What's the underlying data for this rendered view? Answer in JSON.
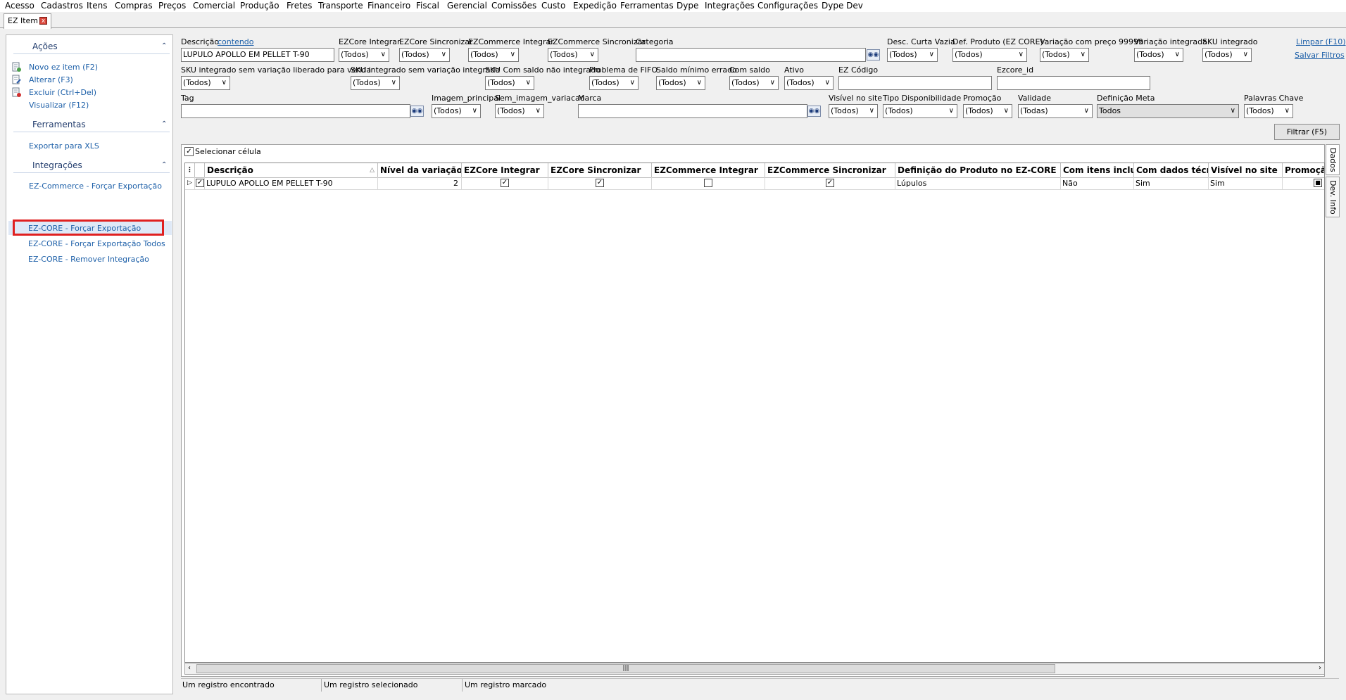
{
  "menu": [
    "Acesso",
    "Cadastros",
    "Itens",
    "Compras",
    "Preços",
    "Comercial",
    "Produção",
    "Fretes",
    "Transporte",
    "Financeiro",
    "Fiscal",
    "Gerencial",
    "Comissões",
    "Custo",
    "Expedição",
    "Ferramentas",
    "Dype",
    "Integrações",
    "Configurações",
    "Dype Dev"
  ],
  "tab": {
    "label": "EZ Item",
    "close": "x"
  },
  "sidebar": {
    "acoes": {
      "title": "Ações",
      "items": [
        "Novo ez item (F2)",
        "Alterar (F3)",
        "Excluir (Ctrl+Del)",
        "Visualizar (F12)"
      ]
    },
    "ferramentas": {
      "title": "Ferramentas",
      "items": [
        "Exportar para XLS"
      ]
    },
    "integracoes": {
      "title": "Integrações",
      "items": [
        "EZ-Commerce - Forçar Exportação",
        "EZ-CORE - Forçar Exportação",
        "EZ-CORE - Forçar Exportação Todos",
        "EZ-CORE - Remover Integração"
      ]
    }
  },
  "filters": {
    "descricao_label": "Descrição",
    "contendo": "contendo",
    "descricao_value": "LUPULO APOLLO EM PELLET T-90",
    "ezcore_integrar": {
      "label": "EZCore Integrar",
      "value": "(Todos)"
    },
    "ezcore_sincronizar": {
      "label": "EZCore Sincronizar",
      "value": "(Todos)"
    },
    "ezcommerce_integrar": {
      "label": "EZCommerce Integrar",
      "value": "(Todos)"
    },
    "ezcommerce_sincronizar": {
      "label": "EZCommerce Sincronizar",
      "value": "(Todos)"
    },
    "categoria_label": "Categoria",
    "desc_curta_vazia": {
      "label": "Desc. Curta Vazia",
      "value": "(Todos)"
    },
    "def_produto": {
      "label": "Def. Produto (EZ CORE)",
      "value": "(Todos)"
    },
    "variacao_preco": {
      "label": "Variação com preço 99999",
      "value": "(Todos)"
    },
    "variacao_integrada": {
      "label": "Variação integrada",
      "value": "(Todos)"
    },
    "sku_integrado": {
      "label": "SKU integrado",
      "value": "(Todos)"
    },
    "limpar": "Limpar (F10)",
    "salvar": "Salvar Filtros",
    "sku_sem_var_lib": {
      "label": "SKU integrado sem variação liberado para venda",
      "value": "(Todos)"
    },
    "sku_sem_var_int": {
      "label": "SKU integrado sem variação integrada",
      "value": "(Todos)"
    },
    "sku_saldo_nao_int": {
      "label": "SKU Com saldo não integrado",
      "value": "(Todos)"
    },
    "problema_fifo": {
      "label": "Problema de FIFO",
      "value": "(Todos)"
    },
    "saldo_min": {
      "label": "Saldo mínimo errado",
      "value": "(Todos)"
    },
    "com_saldo": {
      "label": "Com saldo",
      "value": "(Todos)"
    },
    "ativo": {
      "label": "Ativo",
      "value": "(Todos)"
    },
    "ez_codigo_label": "EZ Código",
    "ezcore_id_label": "Ezcore_id",
    "tag_label": "Tag",
    "imagem_principal": {
      "label": "Imagem_principal",
      "value": "(Todos)"
    },
    "sem_imagem_variacao": {
      "label": "Sem_imagem_variacao",
      "value": "(Todos)"
    },
    "marca_label": "Marca",
    "visivel_site": {
      "label": "Visível no site",
      "value": "(Todos)"
    },
    "tipo_disp": {
      "label": "Tipo Disponibilidade",
      "value": "(Todos)"
    },
    "promocao": {
      "label": "Promoção",
      "value": "(Todos)"
    },
    "validade": {
      "label": "Validade",
      "value": "(Todas)"
    },
    "definicao_meta": {
      "label": "Definição Meta",
      "value": "Todos"
    },
    "palavras_chave": {
      "label": "Palavras Chave",
      "value": "(Todos)"
    },
    "filtrar": "Filtrar (F5)"
  },
  "grid": {
    "selecionar_celula": "Selecionar célula",
    "columns": [
      "Descrição",
      "Nível da variação",
      "EZCore Integrar",
      "EZCore Sincronizar",
      "EZCommerce Integrar",
      "EZCommerce Sincronizar",
      "Definição do Produto no EZ-CORE",
      "Com itens inclu",
      "Com dados técr",
      "Visível no site",
      "Promoçã"
    ],
    "row": {
      "descricao": "LUPULO APOLLO EM PELLET T-90",
      "nivel": "2",
      "ezcore_integrar": true,
      "ezcore_sincronizar": true,
      "ezcommerce_integrar": false,
      "ezcommerce_sincronizar": true,
      "definicao": "Lúpulos",
      "com_itens": "Não",
      "com_dados": "Sim",
      "visivel": "Sim"
    }
  },
  "side_tabs": [
    "Dados",
    "Dev. Info"
  ],
  "status": [
    "Um registro encontrado",
    "Um registro selecionado",
    "Um registro marcado"
  ]
}
